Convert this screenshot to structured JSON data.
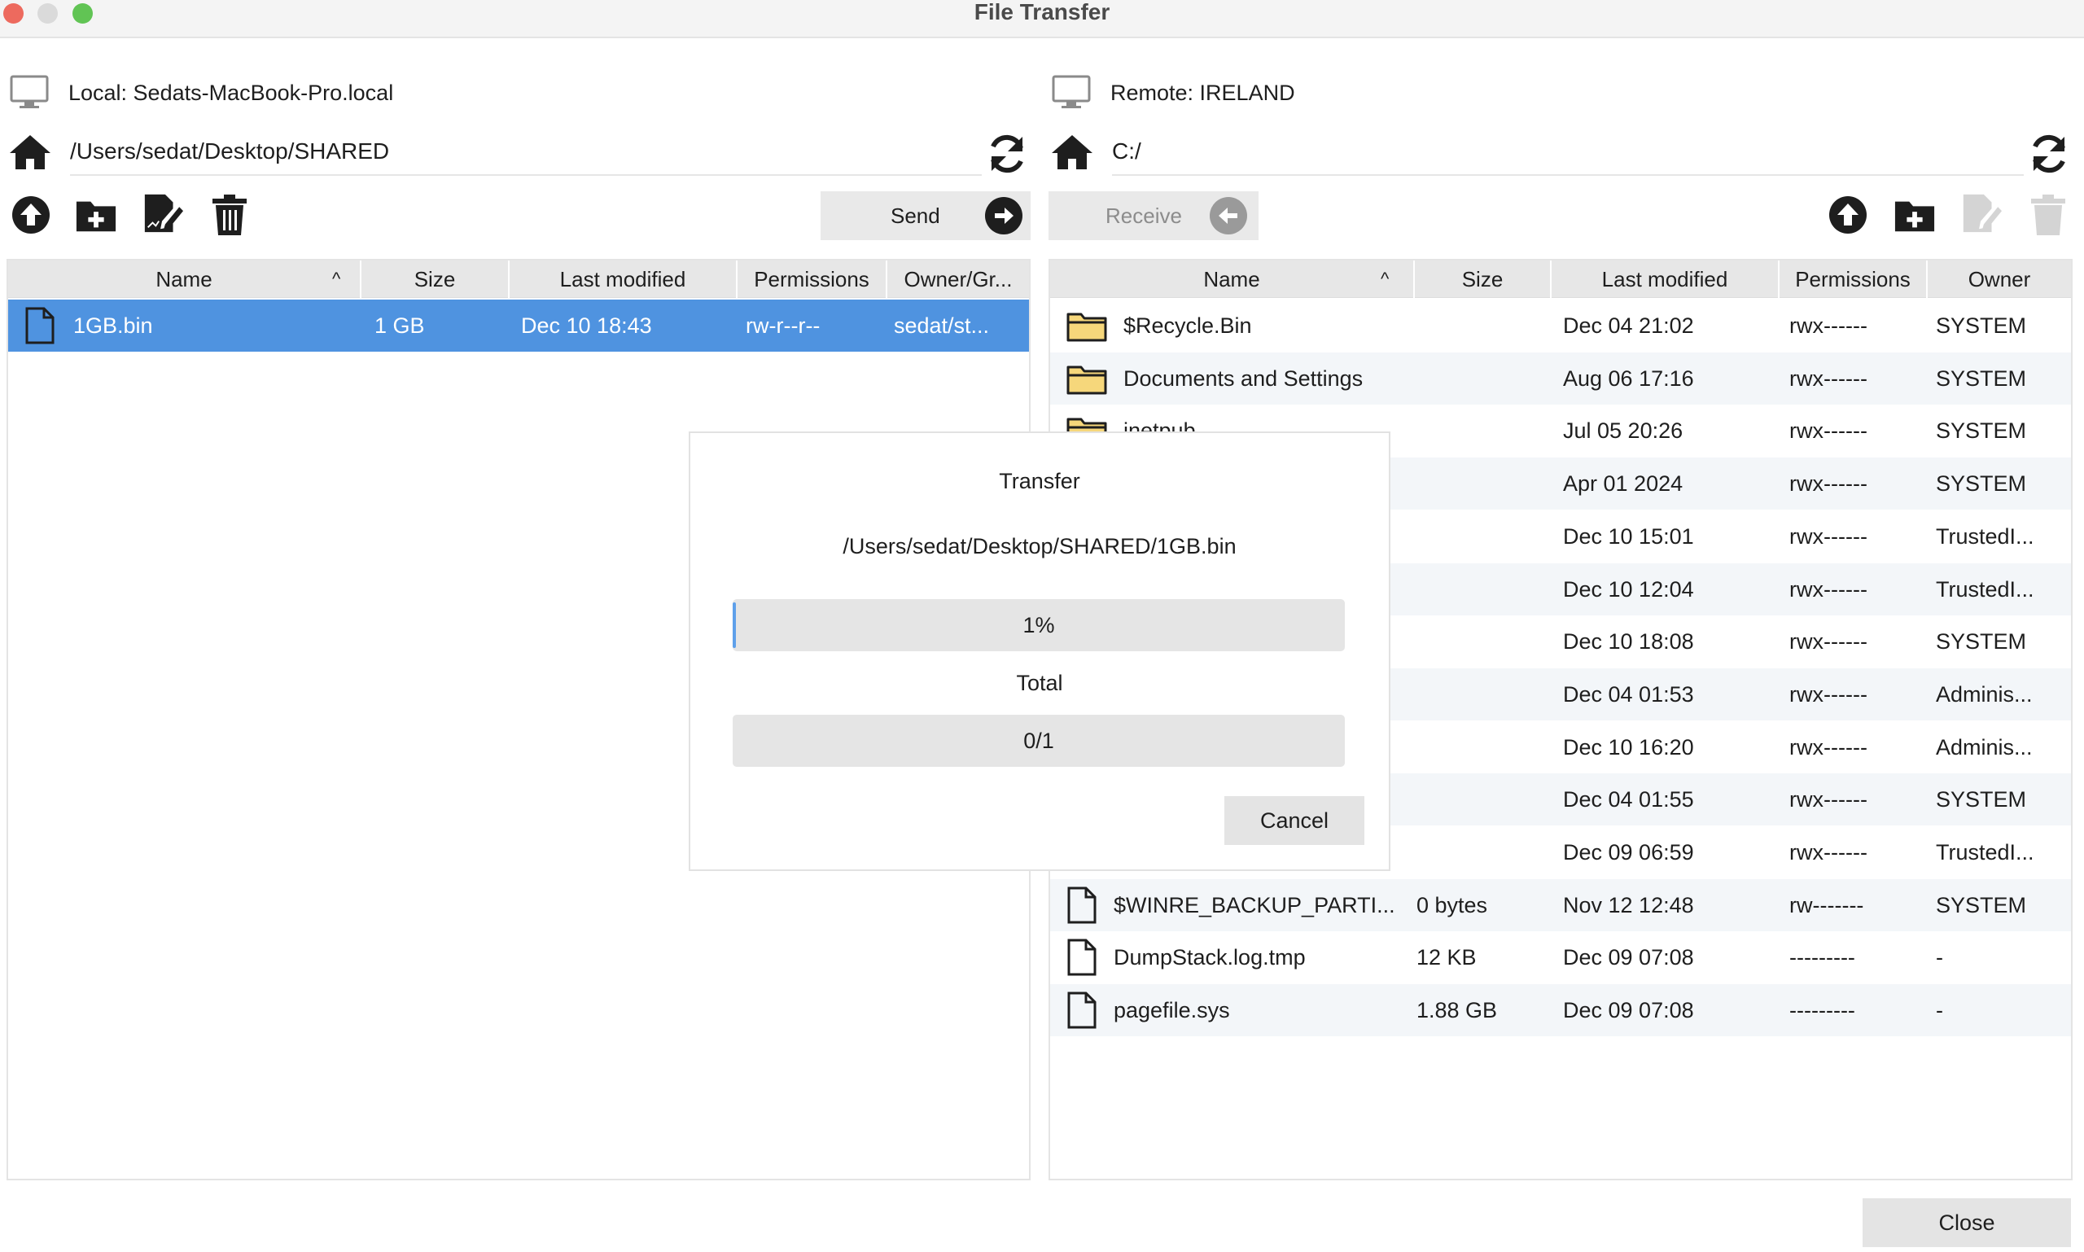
{
  "window": {
    "title": "File Transfer"
  },
  "local": {
    "host_label": "Local: Sedats-MacBook-Pro.local",
    "path": "/Users/sedat/Desktop/SHARED",
    "send_label": "Send",
    "columns": [
      "Name",
      "Size",
      "Last modified",
      "Permissions",
      "Owner/Gr..."
    ],
    "files": [
      {
        "name": "1GB.bin",
        "size": "1 GB",
        "modified": "Dec 10 18:43",
        "permissions": "rw-r--r--",
        "owner": "sedat/st...",
        "type": "file-icon"
      }
    ]
  },
  "remote": {
    "host_label": "Remote: IRELAND",
    "path": "C:/",
    "receive_label": "Receive",
    "columns": [
      "Name",
      "Size",
      "Last modified",
      "Permissions",
      "Owner"
    ],
    "files": [
      {
        "name": "$Recycle.Bin",
        "size": "",
        "modified": "Dec 04 21:02",
        "permissions": "rwx------",
        "owner": "SYSTEM",
        "type": "folder-icon"
      },
      {
        "name": "Documents and Settings",
        "size": "",
        "modified": "Aug 06 17:16",
        "permissions": "rwx------",
        "owner": "SYSTEM",
        "type": "folder-icon"
      },
      {
        "name": "inetpub",
        "size": "",
        "modified": "Jul 05 20:26",
        "permissions": "rwx------",
        "owner": "SYSTEM",
        "type": "folder-icon"
      },
      {
        "name": "",
        "size": "",
        "modified": "Apr 01  2024",
        "permissions": "rwx------",
        "owner": "SYSTEM",
        "type": "folder-icon"
      },
      {
        "name": "",
        "size": "",
        "modified": "Dec 10 15:01",
        "permissions": "rwx------",
        "owner": "TrustedI...",
        "type": "folder-icon"
      },
      {
        "name": "",
        "size": "",
        "modified": "Dec 10 12:04",
        "permissions": "rwx------",
        "owner": "TrustedI...",
        "type": "folder-icon"
      },
      {
        "name": "",
        "size": "",
        "modified": "Dec 10 18:08",
        "permissions": "rwx------",
        "owner": "SYSTEM",
        "type": "folder-icon"
      },
      {
        "name": "",
        "size": "",
        "modified": "Dec 04 01:53",
        "permissions": "rwx------",
        "owner": "Adminis...",
        "type": "folder-icon"
      },
      {
        "name": "..",
        "size": "",
        "modified": "Dec 10 16:20",
        "permissions": "rwx------",
        "owner": "Adminis...",
        "type": "folder-icon"
      },
      {
        "name": "",
        "size": "",
        "modified": "Dec 04 01:55",
        "permissions": "rwx------",
        "owner": "SYSTEM",
        "type": "folder-icon"
      },
      {
        "name": "",
        "size": "",
        "modified": "Dec 09 06:59",
        "permissions": "rwx------",
        "owner": "TrustedI...",
        "type": "folder-icon"
      },
      {
        "name": "$WINRE_BACKUP_PARTI...",
        "size": "0 bytes",
        "modified": "Nov 12 12:48",
        "permissions": "rw-------",
        "owner": "SYSTEM",
        "type": "file-icon"
      },
      {
        "name": "DumpStack.log.tmp",
        "size": "12 KB",
        "modified": "Dec 09 07:08",
        "permissions": "---------",
        "owner": "-",
        "type": "file-icon"
      },
      {
        "name": "pagefile.sys",
        "size": "1.88 GB",
        "modified": "Dec 09 07:08",
        "permissions": "---------",
        "owner": "-",
        "type": "file-icon"
      }
    ]
  },
  "dialog": {
    "title": "Transfer",
    "file_path": "/Users/sedat/Desktop/SHARED/1GB.bin",
    "progress_text": "1%",
    "progress": 0.01,
    "total_label": "Total",
    "total_text": "0/1",
    "total_progress": 0,
    "cancel_label": "Cancel"
  },
  "footer": {
    "close_label": "Close"
  },
  "colors": {
    "selection": "#4f93e0",
    "folder": "#f6d77b",
    "accent": "#5ea0ea"
  }
}
